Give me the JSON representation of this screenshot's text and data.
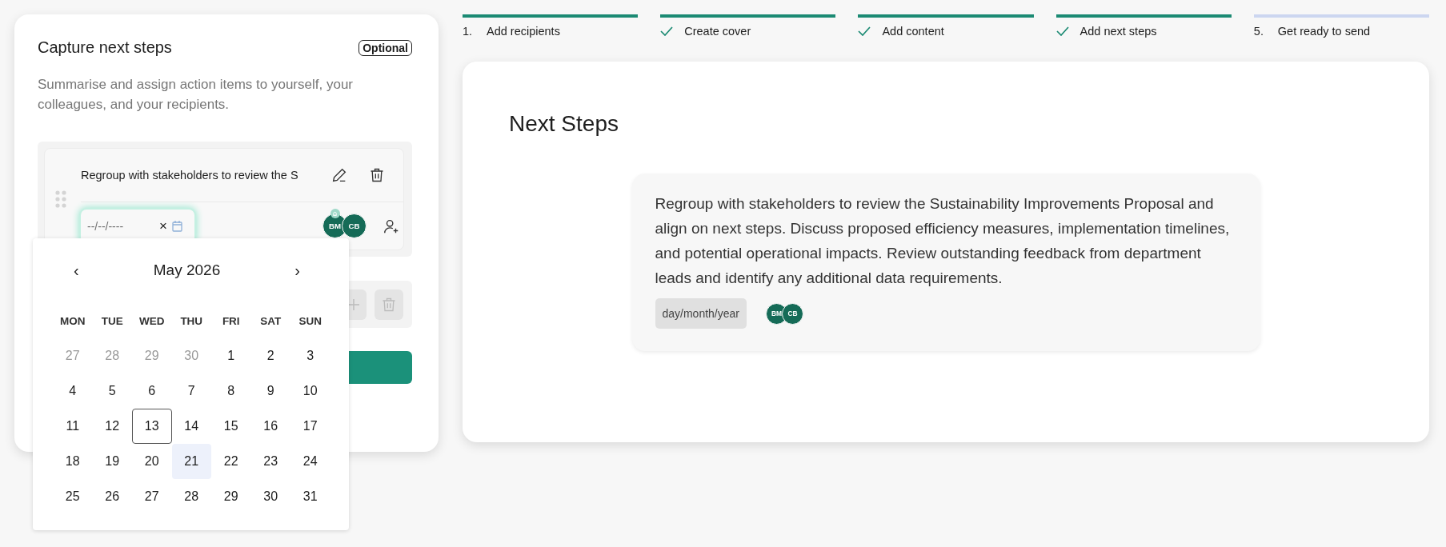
{
  "steps": [
    {
      "number": "1.",
      "label": "Add recipients",
      "checked": false,
      "reached": true
    },
    {
      "label": "Create cover",
      "checked": true,
      "reached": true
    },
    {
      "label": "Add content",
      "checked": true,
      "reached": true
    },
    {
      "label": "Add next steps",
      "checked": true,
      "reached": true
    },
    {
      "number": "5.",
      "label": "Get ready to send",
      "checked": false,
      "reached": false
    }
  ],
  "panel": {
    "title": "Capture next steps",
    "badge": "Optional",
    "description": "Summarise and assign action items to yourself, your colleagues, and your recipients.",
    "item": {
      "text": "Regroup with stakeholders to review the S",
      "date_field": {
        "placeholder": "--/--/----",
        "clear": "×",
        "focused": true
      },
      "assignees": [
        {
          "initials": "BM",
          "notified": true
        },
        {
          "initials": "CB",
          "notified": false
        }
      ]
    },
    "new_item": {
      "disabled": true
    }
  },
  "calendar": {
    "month": "May 2026",
    "prev": "‹",
    "next": "›",
    "weekdays": [
      "MON",
      "TUE",
      "WED",
      "THU",
      "FRI",
      "SAT",
      "SUN"
    ],
    "days": [
      {
        "label": "27",
        "outside": true,
        "today": false,
        "selected": false
      },
      {
        "label": "28",
        "outside": true,
        "today": false,
        "selected": false
      },
      {
        "label": "29",
        "outside": true,
        "today": false,
        "selected": false
      },
      {
        "label": "30",
        "outside": true,
        "today": false,
        "selected": false
      },
      {
        "label": "1",
        "outside": false,
        "today": false,
        "selected": false
      },
      {
        "label": "2",
        "outside": false,
        "today": false,
        "selected": false
      },
      {
        "label": "3",
        "outside": false,
        "today": false,
        "selected": false
      },
      {
        "label": "4",
        "outside": false,
        "today": false,
        "selected": false
      },
      {
        "label": "5",
        "outside": false,
        "today": false,
        "selected": false
      },
      {
        "label": "6",
        "outside": false,
        "today": false,
        "selected": false
      },
      {
        "label": "7",
        "outside": false,
        "today": false,
        "selected": false
      },
      {
        "label": "8",
        "outside": false,
        "today": false,
        "selected": false
      },
      {
        "label": "9",
        "outside": false,
        "today": false,
        "selected": false
      },
      {
        "label": "10",
        "outside": false,
        "today": false,
        "selected": false
      },
      {
        "label": "11",
        "outside": false,
        "today": false,
        "selected": false
      },
      {
        "label": "12",
        "outside": false,
        "today": false,
        "selected": false
      },
      {
        "label": "13",
        "outside": false,
        "today": true,
        "selected": false
      },
      {
        "label": "14",
        "outside": false,
        "today": false,
        "selected": false
      },
      {
        "label": "15",
        "outside": false,
        "today": false,
        "selected": false
      },
      {
        "label": "16",
        "outside": false,
        "today": false,
        "selected": false
      },
      {
        "label": "17",
        "outside": false,
        "today": false,
        "selected": false
      },
      {
        "label": "18",
        "outside": false,
        "today": false,
        "selected": false
      },
      {
        "label": "19",
        "outside": false,
        "today": false,
        "selected": false
      },
      {
        "label": "20",
        "outside": false,
        "today": false,
        "selected": false
      },
      {
        "label": "21",
        "outside": false,
        "today": false,
        "selected": true
      },
      {
        "label": "22",
        "outside": false,
        "today": false,
        "selected": false
      },
      {
        "label": "23",
        "outside": false,
        "today": false,
        "selected": false
      },
      {
        "label": "24",
        "outside": false,
        "today": false,
        "selected": false
      },
      {
        "label": "25",
        "outside": false,
        "today": false,
        "selected": false
      },
      {
        "label": "26",
        "outside": false,
        "today": false,
        "selected": false
      },
      {
        "label": "27",
        "outside": false,
        "today": false,
        "selected": false
      },
      {
        "label": "28",
        "outside": false,
        "today": false,
        "selected": false
      },
      {
        "label": "29",
        "outside": false,
        "today": false,
        "selected": false
      },
      {
        "label": "30",
        "outside": false,
        "today": false,
        "selected": false
      },
      {
        "label": "31",
        "outside": false,
        "today": false,
        "selected": false
      }
    ]
  },
  "preview": {
    "title": "Next Steps",
    "text": "Regroup with stakeholders to review the Sustainability Improvements Proposal and align on next steps. Discuss proposed efficiency measures, implementation timelines, and potential operational impacts. Review outstanding feedback from department leads and identify any additional data requirements.",
    "date": "day/month/year",
    "assignees": [
      {
        "initials": "BM",
        "notified": false
      },
      {
        "initials": "CB",
        "notified": false
      }
    ]
  }
}
